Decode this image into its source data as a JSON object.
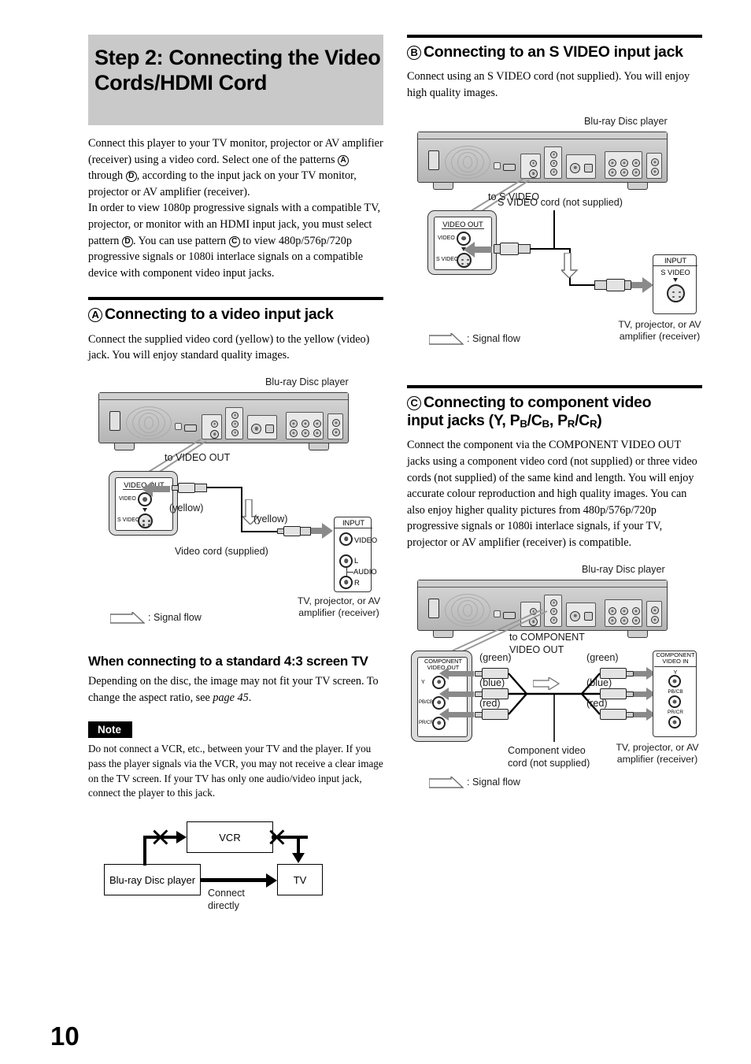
{
  "page": {
    "number": "10"
  },
  "main_title": "Step 2: Connecting the Video Cords/HDMI Cord",
  "intro": {
    "line1": "Connect this player to your TV monitor, projector or AV amplifier (receiver) using a video cord. Select one of the patterns",
    "a": "A",
    "mid1": "through",
    "d": "D",
    "mid2": ", according to the input jack on your TV monitor, projector or AV amplifier (receiver).",
    "line2": "In order to view 1080p progressive signals with a compatible TV, projector, or monitor with an HDMI input jack, you must select pattern",
    "d2": "D",
    "mid3": ". You can use pattern",
    "c": "C",
    "mid4": "to view 480p/576p/720p progressive signals or 1080i interlace signals on a compatible device with component video input jacks."
  },
  "section_a": {
    "badge": "A",
    "title": "Connecting to a video input jack",
    "body": "Connect the supplied video cord (yellow) to the yellow (video) jack. You will enjoy standard quality images.",
    "diagram": {
      "device_label": "Blu-ray Disc player",
      "callout_title": "VIDEO OUT",
      "jack_video": "VIDEO",
      "jack_svideo": "S VIDEO",
      "to_label": "to VIDEO OUT",
      "colour_left": "(yellow)",
      "colour_right": "(yellow)",
      "cord_label": "Video cord (supplied)",
      "input_title": "INPUT",
      "input_video": "VIDEO",
      "input_l": "L",
      "input_audio": "AUDIO",
      "input_r": "R",
      "tv_label": "TV, projector, or AV amplifier (receiver)",
      "legend": ": Signal flow"
    }
  },
  "subsection_43": {
    "title": "When connecting to a standard 4:3 screen TV",
    "body_before": "Depending on the disc, the image may not fit your TV screen. To change the aspect ratio, see ",
    "body_italic": "page 45",
    "body_after": "."
  },
  "note": {
    "badge": "Note",
    "text": "Do not connect a VCR, etc., between your TV and the player. If you pass the player signals via the VCR, you may not receive a clear image on the TV screen. If your TV has only one audio/video input jack, connect the player to this jack."
  },
  "vcr_diagram": {
    "vcr": "VCR",
    "player": "Blu-ray Disc player",
    "tv": "TV",
    "connect_directly_1": "Connect",
    "connect_directly_2": "directly"
  },
  "section_b": {
    "badge": "B",
    "title": "Connecting to an S VIDEO input jack",
    "body": "Connect using an S VIDEO cord (not supplied). You will enjoy high quality images.",
    "diagram": {
      "device_label": "Blu-ray Disc player",
      "callout_title": "VIDEO OUT",
      "jack_video": "VIDEO",
      "jack_svideo": "S VIDEO",
      "to_label": "to S VIDEO",
      "cord_label": "S VIDEO cord (not supplied)",
      "input_title": "INPUT",
      "input_svideo": "S VIDEO",
      "tv_label": "TV, projector, or AV amplifier (receiver)",
      "legend": ": Signal flow"
    }
  },
  "section_c": {
    "badge": "C",
    "title_line1": "Connecting to component video",
    "title_line2_pre": "input jacks (Y, P",
    "title_sub_b1": "B",
    "title_mid1": "/C",
    "title_sub_b2": "B",
    "title_mid2": ", P",
    "title_sub_r1": "R",
    "title_mid3": "/C",
    "title_sub_r2": "R",
    "title_end": ")",
    "body": "Connect the component via the COMPONENT VIDEO OUT jacks using a component video cord (not supplied) or three video cords (not supplied) of the same kind and length. You will enjoy accurate colour reproduction and high quality images. You can also enjoy higher quality pictures from 480p/576p/720p progressive signals or 1080i interlace signals, if your TV, projector or AV amplifier (receiver) is compatible.",
    "diagram": {
      "device_label": "Blu-ray Disc player",
      "to_label_1": "to COMPONENT",
      "to_label_2": "VIDEO OUT",
      "out_title_1": "COMPONENT",
      "out_title_2": "VIDEO OUT",
      "in_title_1": "COMPONENT",
      "in_title_2": "VIDEO IN",
      "jack_y": "Y",
      "jack_pb": "PB/CB",
      "jack_pr": "PR/CR",
      "colour_green_left": "(green)",
      "colour_blue_left": "(blue)",
      "colour_red_left": "(red)",
      "colour_green_right": "(green)",
      "colour_blue_right": "(blue)",
      "colour_red_right": "(red)",
      "cord_label_1": "Component video",
      "cord_label_2": "cord (not supplied)",
      "tv_label": "TV, projector, or AV amplifier (receiver)",
      "legend": ": Signal flow"
    }
  },
  "colors": {
    "title_band": "#c9c9c9",
    "rule": "#000000",
    "arrow_grey": "#8a8a8a"
  }
}
